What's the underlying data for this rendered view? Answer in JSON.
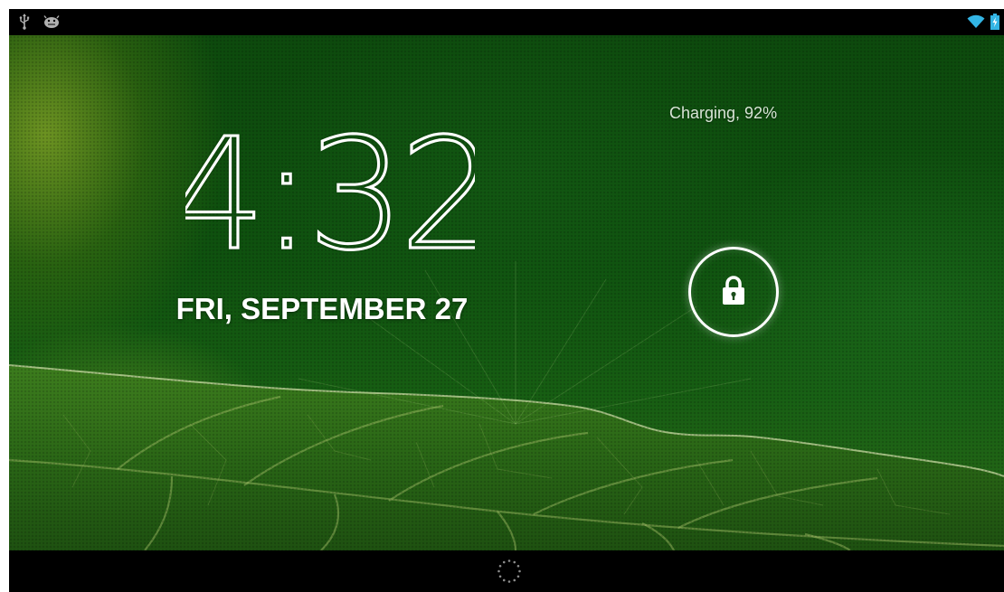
{
  "status_bar": {
    "left_icons": [
      "usb-icon",
      "android-debug-icon"
    ],
    "right_icons": [
      "wifi-icon",
      "battery-charging-icon"
    ]
  },
  "lockscreen": {
    "time": "4:32",
    "date": "FRI, SEPTEMBER 27",
    "charging_status": "Charging, 92%",
    "unlock_icon": "padlock-icon"
  },
  "nav_bar": {
    "center_icon": "camera-dots-icon"
  },
  "colors": {
    "status_bar": "#000000",
    "wallpaper_green": "#0f520f",
    "text": "#ffffff",
    "wifi": "#33b5e5",
    "battery": "#33b5e5"
  }
}
